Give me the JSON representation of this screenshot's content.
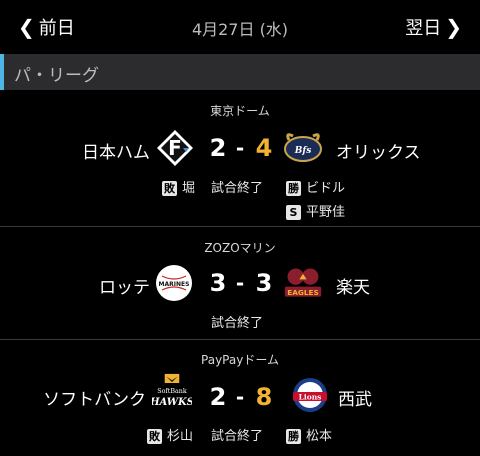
{
  "header": {
    "prev_label": "前日",
    "prev_icon": "chevron-left-icon",
    "date": "4月27日 (水)",
    "next_label": "翌日",
    "next_icon": "chevron-right-icon"
  },
  "league": {
    "name": "パ・リーグ",
    "accent": "#4fb4e6"
  },
  "colors": {
    "winning_score": "#f2b233",
    "normal_score": "#ffffff"
  },
  "games": [
    {
      "venue": "東京ドーム",
      "home": "日本ハム",
      "home_logo": "fighters-logo",
      "home_score": "2",
      "away_score": "4",
      "away": "オリックス",
      "away_logo": "buffaloes-logo",
      "status": "試合終了",
      "loss_badge": "敗",
      "loss_pitcher": "堀",
      "win_badge": "勝",
      "win_pitcher": "ビドル",
      "save_badge": "S",
      "save_pitcher": "平野佳"
    },
    {
      "venue": "ZOZOマリン",
      "home": "ロッテ",
      "home_logo": "marines-logo",
      "home_score": "3",
      "away_score": "3",
      "away": "楽天",
      "away_logo": "eagles-logo",
      "status": "試合終了"
    },
    {
      "venue": "PayPayドーム",
      "home": "ソフトバンク",
      "home_logo": "hawks-logo",
      "home_score": "2",
      "away_score": "8",
      "away": "西武",
      "away_logo": "lions-logo",
      "status": "試合終了",
      "loss_badge": "敗",
      "loss_pitcher": "杉山",
      "win_badge": "勝",
      "win_pitcher": "松本"
    }
  ]
}
